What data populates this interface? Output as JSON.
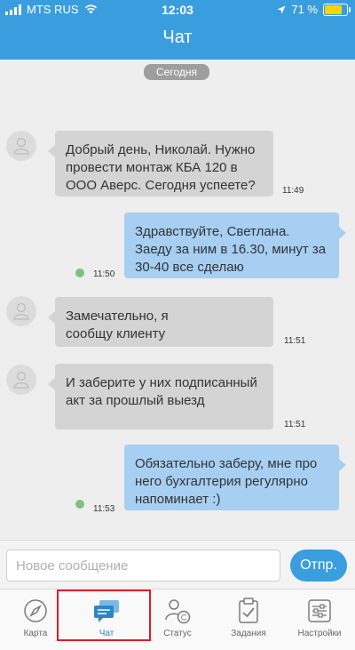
{
  "status_bar": {
    "carrier": "MTS RUS",
    "time": "12:03",
    "battery": "71 %"
  },
  "header": {
    "title": "Чат"
  },
  "chat": {
    "date_label": "Сегодня",
    "messages": [
      {
        "direction": "incoming",
        "text": "Добрый день, Николай. Нужно провести монтаж КБА 120 в ООО Аверс. Сегодня успеете?",
        "time": "11:49"
      },
      {
        "direction": "outgoing",
        "text": "Здравствуйте, Светлана. Заеду за ним в 16.30, минут за 30-40 все сделаю",
        "time": "11:50"
      },
      {
        "direction": "incoming",
        "text": "Замечательно, я сообщу клиенту",
        "time": "11:51"
      },
      {
        "direction": "incoming",
        "text": "И заберите у них подписанный акт за прошлый выезд",
        "time": "11:51"
      },
      {
        "direction": "outgoing",
        "text": "Обязательно заберу, мне про него бухгалтерия регулярно напоминает :)",
        "time": "11:53"
      }
    ]
  },
  "composer": {
    "placeholder": "Новое сообщение",
    "send_label": "Отпр."
  },
  "tabs": [
    {
      "label": "Карта",
      "icon": "compass-icon"
    },
    {
      "label": "Чат",
      "icon": "chat-icon"
    },
    {
      "label": "Статус",
      "icon": "status-icon"
    },
    {
      "label": "Задания",
      "icon": "tasks-icon"
    },
    {
      "label": "Настройки",
      "icon": "settings-icon"
    }
  ],
  "colors": {
    "header": "#3a9ede",
    "incoming_bubble": "#d4d4d4",
    "outgoing_bubble": "#a6cff2",
    "highlight": "#d71f2a"
  }
}
